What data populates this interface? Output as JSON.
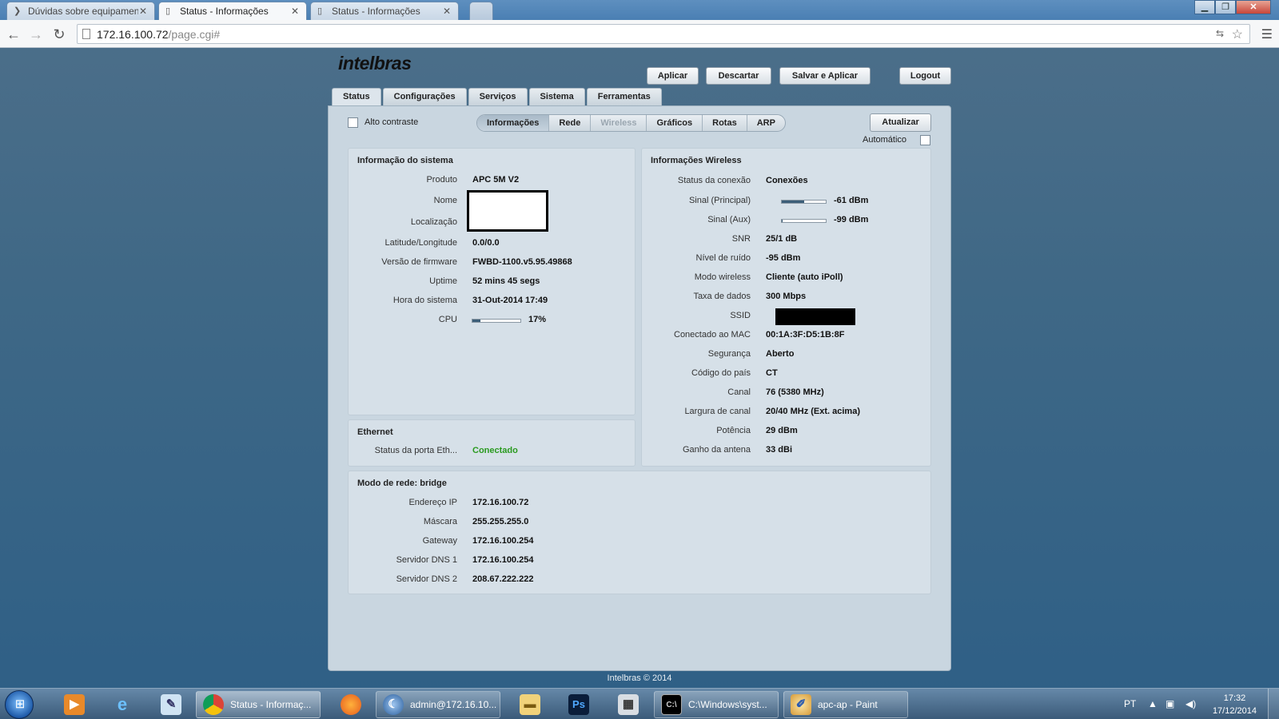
{
  "browser": {
    "tabs": [
      {
        "label": "Dúvidas sobre equipamen",
        "icon": "chevron-icon"
      },
      {
        "label": "Status - Informações",
        "icon": "page-icon"
      },
      {
        "label": "Status - Informações",
        "icon": "page-icon"
      }
    ],
    "url_host": "172.16.100.72",
    "url_path": "/page.cgi#"
  },
  "header": {
    "logo": "intelbras",
    "buttons": {
      "apply": "Aplicar",
      "discard": "Descartar",
      "save_apply": "Salvar e Aplicar",
      "logout": "Logout"
    }
  },
  "main_tabs": [
    "Status",
    "Configurações",
    "Serviços",
    "Sistema",
    "Ferramentas"
  ],
  "toolbar": {
    "high_contrast": "Alto contraste",
    "sub_tabs": [
      "Informações",
      "Rede",
      "Wireless",
      "Gráficos",
      "Rotas",
      "ARP"
    ],
    "refresh": "Atualizar",
    "auto": "Automático"
  },
  "system_info": {
    "title": "Informação do sistema",
    "rows": [
      {
        "k": "Produto",
        "v": "APC 5M V2"
      },
      {
        "k": "Nome",
        "v": ""
      },
      {
        "k": "Localização",
        "v": ""
      },
      {
        "k": "Latitude/Longitude",
        "v": "0.0/0.0"
      },
      {
        "k": "Versão de firmware",
        "v": "FWBD-1100.v5.95.49868"
      },
      {
        "k": "Uptime",
        "v": "52 mins 45 segs"
      },
      {
        "k": "Hora do sistema",
        "v": "31-Out-2014 17:49"
      },
      {
        "k": "CPU",
        "v": "17%"
      }
    ],
    "cpu_fraction": 0.17
  },
  "ethernet": {
    "title": "Ethernet",
    "k": "Status da porta Eth...",
    "v": "Conectado",
    "status_color": "#2a9a1f"
  },
  "wireless_info": {
    "title": "Informações Wireless",
    "rows": [
      {
        "k": "Status da conexão",
        "v": "Conexões"
      },
      {
        "k": "Sinal (Principal)",
        "v": "-61 dBm"
      },
      {
        "k": "Sinal (Aux)",
        "v": "-99 dBm"
      },
      {
        "k": "SNR",
        "v": "25/1 dB"
      },
      {
        "k": "Nível de ruído",
        "v": "-95 dBm"
      },
      {
        "k": "Modo wireless",
        "v": "Cliente (auto iPoll)"
      },
      {
        "k": "Taxa de dados",
        "v": "300 Mbps"
      },
      {
        "k": "SSID",
        "v": ""
      },
      {
        "k": "Conectado ao MAC",
        "v": "00:1A:3F:D5:1B:8F"
      },
      {
        "k": "Segurança",
        "v": "Aberto"
      },
      {
        "k": "Código do país",
        "v": "CT"
      },
      {
        "k": "Canal",
        "v": "76 (5380 MHz)"
      },
      {
        "k": "Largura de canal",
        "v": "20/40 MHz (Ext. acima)"
      },
      {
        "k": "Potência",
        "v": "29 dBm"
      },
      {
        "k": "Ganho da antena",
        "v": "33 dBi"
      }
    ],
    "signal_main_fraction": 0.5,
    "signal_aux_fraction": 0.02
  },
  "network": {
    "title": "Modo de rede: bridge",
    "rows": [
      {
        "k": "Endereço IP",
        "v": "172.16.100.72"
      },
      {
        "k": "Máscara",
        "v": "255.255.255.0"
      },
      {
        "k": "Gateway",
        "v": "172.16.100.254"
      },
      {
        "k": "Servidor DNS 1",
        "v": "172.16.100.254"
      },
      {
        "k": "Servidor DNS 2",
        "v": "208.67.222.222"
      }
    ]
  },
  "footer": "Intelbras © 2014",
  "taskbar": {
    "items": [
      {
        "label": "Status - Informaç..."
      },
      {
        "label": "admin@172.16.10..."
      },
      {
        "label": "C:\\Windows\\syst..."
      },
      {
        "label": "apc-ap - Paint"
      }
    ],
    "lang": "PT",
    "time": "17:32",
    "date": "17/12/2014"
  }
}
